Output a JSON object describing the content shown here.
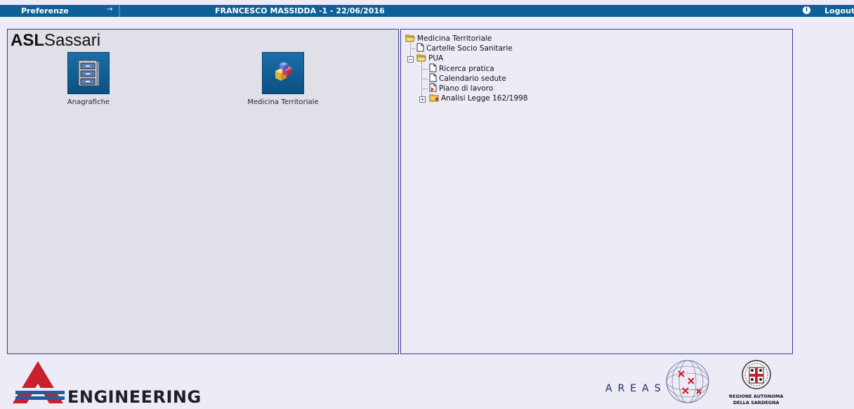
{
  "topbar": {
    "preferences_label": "Preferenze",
    "arrow_glyph": "→",
    "user_info": "FRANCESCO MASSIDDA -1 - 22/06/2016",
    "info_glyph": "i",
    "logout_label": "Logout"
  },
  "left_panel": {
    "logo_bold": "ASL",
    "logo_regular": "Sassari",
    "apps": [
      {
        "label": "Anagrafiche",
        "icon": "filing-cabinet-icon"
      },
      {
        "label": "Medicina Territoriale",
        "icon": "cubes-icon"
      }
    ]
  },
  "tree": {
    "root": "Medicina Territoriale",
    "items": [
      {
        "label": "Cartelle Socio Sanitarie",
        "icon": "document-icon"
      },
      {
        "label": "PUA",
        "icon": "open-folder-icon",
        "expanded": true
      },
      {
        "label": "Ricerca pratica",
        "icon": "document-icon"
      },
      {
        "label": "Calendario sedute",
        "icon": "document-icon"
      },
      {
        "label": "Piano di lavoro",
        "icon": "document-red-icon"
      },
      {
        "label": "Analisi Legge 162/1998",
        "icon": "folder-icon",
        "expanded": false
      }
    ]
  },
  "footer": {
    "engineering": "ENGINEERING",
    "areas": "AREAS",
    "regione_line1": "REGIONE AUTONOMA",
    "regione_line2": "DELLA SARDEGNA"
  },
  "colors": {
    "topbar": "#0d6196",
    "panel_border": "#3a3aa0",
    "left_panel_bg": "#e0e1e8",
    "page_bg": "#ecebf6",
    "engineering_red": "#c8202f",
    "engineering_blue": "#1f5fa0"
  }
}
